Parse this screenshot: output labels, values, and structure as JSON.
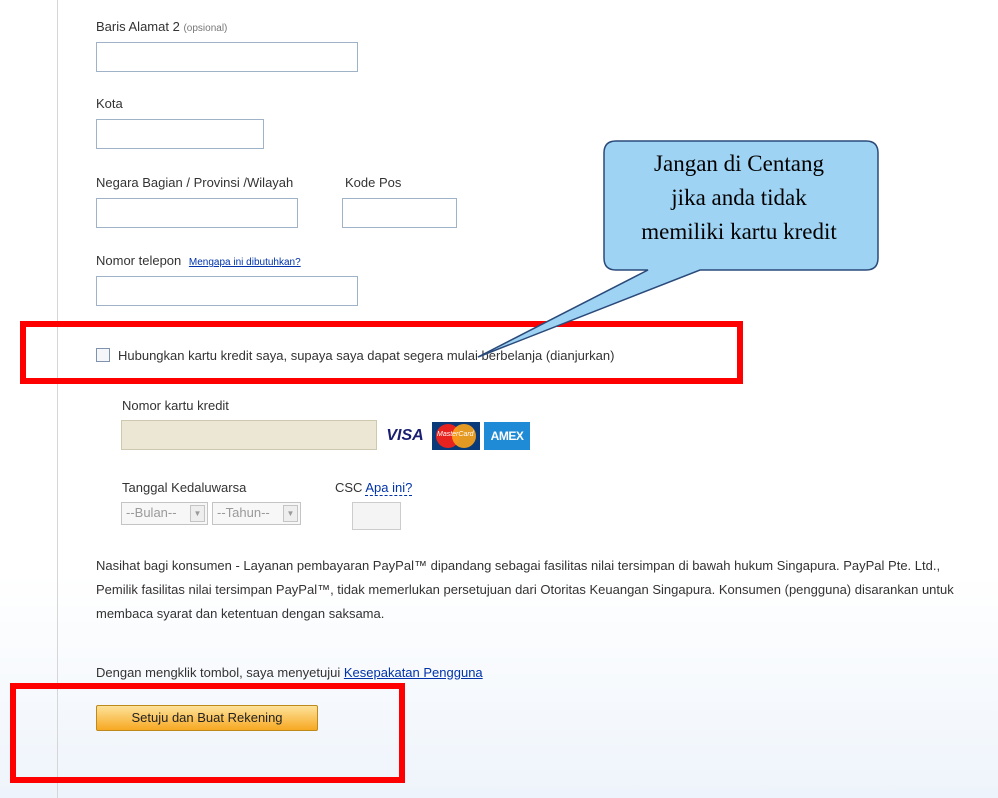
{
  "form": {
    "address2": {
      "label": "Baris Alamat 2",
      "optional": "(opsional)",
      "value": ""
    },
    "city": {
      "label": "Kota",
      "value": ""
    },
    "state": {
      "label": "Negara Bagian / Provinsi /Wilayah",
      "value": ""
    },
    "postal": {
      "label": "Kode Pos",
      "value": ""
    },
    "phone": {
      "label": "Nomor telepon",
      "help_link": "Mengapa ini dibutuhkan?",
      "value": ""
    },
    "link_card": {
      "label": "Hubungkan kartu kredit saya, supaya saya dapat segera mulai berbelanja (dianjurkan)",
      "checked": false
    },
    "card_number": {
      "label": "Nomor kartu kredit",
      "value": ""
    },
    "card_logos": {
      "visa": "VISA",
      "mastercard": "MasterCard",
      "amex": "AMEX"
    },
    "expiry": {
      "label": "Tanggal Kedaluwarsa",
      "month": "--Bulan--",
      "year": "--Tahun--"
    },
    "csc": {
      "label": "CSC",
      "help_link": "Apa ini?",
      "value": ""
    }
  },
  "disclaimer": "Nasihat bagi konsumen - Layanan pembayaran PayPal™ dipandang sebagai fasilitas nilai tersimpan di bawah hukum Singapura. PayPal Pte. Ltd., Pemilik fasilitas nilai tersimpan PayPal™, tidak memerlukan persetujuan dari Otoritas Keuangan Singapura. Konsumen (pengguna) disarankan untuk membaca syarat dan ketentuan dengan saksama.",
  "agreement": {
    "prefix": "Dengan mengklik tombol, saya menyetujui",
    "link": "Kesepakatan Pengguna"
  },
  "submit_label": "Setuju dan Buat Rekening",
  "callout": {
    "line1": "Jangan di Centang",
    "line2": "jika anda tidak",
    "line3": "memiliki kartu kredit",
    "fill": "#9fd3f4",
    "stroke": "#2a4a7a"
  },
  "highlight_color": "#ff0000"
}
